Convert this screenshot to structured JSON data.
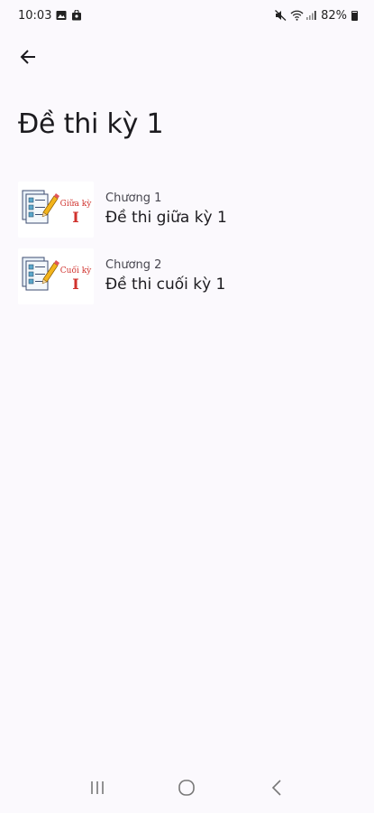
{
  "status_bar": {
    "time": "10:03",
    "battery": "82%",
    "battery_level": 0.82,
    "icons": [
      "gallery-icon",
      "shopping-bag-icon",
      "mute-icon",
      "wifi-icon",
      "signal-icon",
      "battery-icon"
    ]
  },
  "header": {
    "back_icon": "arrow-left-icon",
    "title": "Đề thi kỳ 1"
  },
  "items": [
    {
      "overline": "Chương 1",
      "title": "Đề thi giữa kỳ 1",
      "thumb_text_top": "Giữa kỳ",
      "thumb_text_bottom": "I",
      "thumb_icon": "exam-checklist-icon"
    },
    {
      "overline": "Chương 2",
      "title": "Đề thi cuối kỳ 1",
      "thumb_text_top": "Cuối kỳ",
      "thumb_text_bottom": "I",
      "thumb_icon": "exam-checklist-icon"
    }
  ],
  "colors": {
    "background": "#fbf9fd",
    "thumb_text": "#d0322d",
    "pencil": "#f2b41c",
    "checkbox": "#5aa6c9"
  },
  "nav_bar": {
    "icons": [
      "recent-apps-icon",
      "home-icon",
      "back-icon"
    ]
  }
}
